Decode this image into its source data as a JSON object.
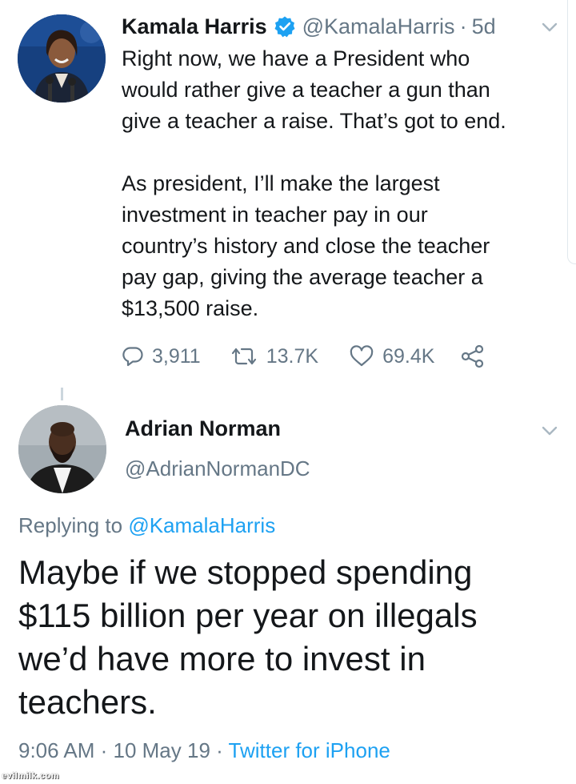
{
  "tweet": {
    "author_name": "Kamala Harris",
    "author_handle": "@KamalaHarris",
    "separator": "·",
    "time_ago": "5d",
    "paragraphs": [
      "Right now, we have a President who\nwould rather give a teacher a gun than\ngive a teacher a raise. That’s got to end.",
      "As president, I’ll make the largest\ninvestment in teacher pay in our\ncountry’s history and close the teacher\npay gap, giving the average teacher a\n$13,500 raise."
    ],
    "stats": {
      "replies": "3,911",
      "retweets": "13.7K",
      "likes": "69.4K"
    }
  },
  "reply": {
    "author_name": "Adrian Norman",
    "author_handle": "@AdrianNormanDC",
    "replying_to_prefix": "Replying to ",
    "replying_to_handle": "@KamalaHarris",
    "text": "Maybe if we stopped spending\n$115 billion per year on illegals\nwe’d have more to invest in\nteachers.",
    "timestamp": "9:06 AM · 10 May 19 · ",
    "source": "Twitter for iPhone"
  },
  "watermark": "evilmilk.com",
  "colors": {
    "text": "#14171a",
    "secondary": "#657786",
    "link": "#1da1f2",
    "verified": "#1da1f2"
  },
  "icons": [
    "verified-badge-icon",
    "chevron-down-icon",
    "reply-icon",
    "retweet-icon",
    "like-icon",
    "share-icon"
  ]
}
